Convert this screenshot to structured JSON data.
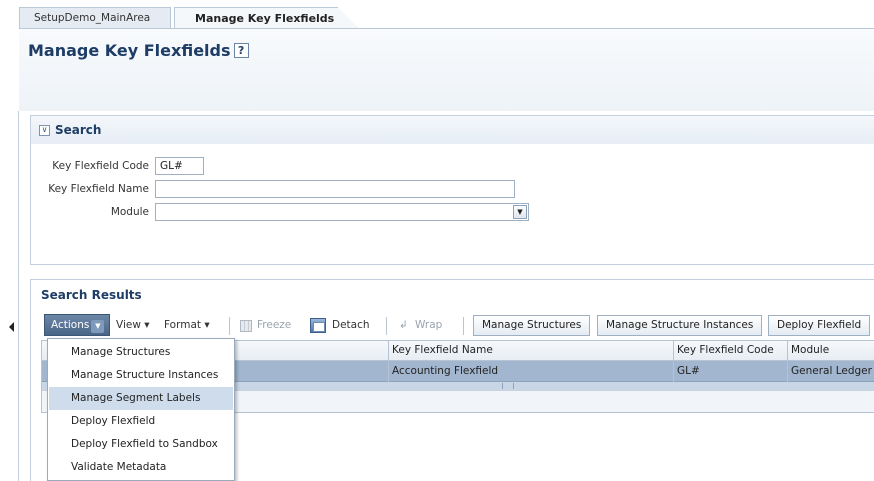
{
  "tabs": [
    {
      "label": "SetupDemo_MainArea"
    },
    {
      "label": "Manage Key Flexfields"
    }
  ],
  "page": {
    "title": "Manage Key Flexfields",
    "help_icon": "?"
  },
  "search": {
    "title": "Search",
    "fields": [
      {
        "label": "Key Flexfield Code",
        "value": "GL#"
      },
      {
        "label": "Key Flexfield Name",
        "value": ""
      },
      {
        "label": "Module",
        "value": ""
      }
    ]
  },
  "results": {
    "title": "Search Results",
    "toolbar": {
      "actions": "Actions",
      "view": "View ▾",
      "format": "Format ▾",
      "freeze": "Freeze",
      "detach": "Detach",
      "wrap": "Wrap",
      "manage_structures": "Manage Structures",
      "manage_structure_instances": "Manage Structure Instances",
      "deploy_flexfield": "Deploy Flexfield"
    },
    "columns": [
      "Key Flexfield Name",
      "Key Flexfield Code",
      "Module"
    ],
    "rows": [
      {
        "name": "Accounting Flexfield",
        "code": "GL#",
        "module": "General Ledger"
      }
    ]
  },
  "actions_menu": {
    "items": [
      "Manage Structures",
      "Manage Structure Instances",
      "Manage Segment Labels",
      "Deploy Flexfield",
      "Deploy Flexfield to Sandbox",
      "Validate Metadata"
    ],
    "highlighted_index": 2
  }
}
